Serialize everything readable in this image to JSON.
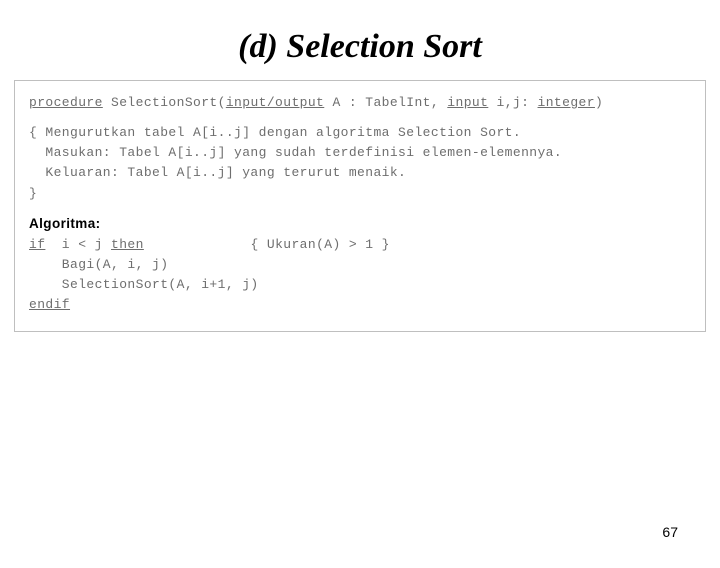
{
  "title": "(d)  Selection Sort",
  "sig": {
    "kw_procedure": "procedure",
    "name": " SelectionSort(",
    "kw_io": "input/output",
    "part1": " A : TabelInt, ",
    "kw_input": "input",
    "part2": " i,j: ",
    "kw_integer": "integer",
    "close": ")"
  },
  "comments": {
    "l1": "{ Mengurutkan tabel A[i..j] dengan algoritma Selection Sort.",
    "l2": "  Masukan: Tabel A[i..j] yang sudah terdefinisi elemen-elemennya.",
    "l3": "  Keluaran: Tabel A[i..j] yang terurut menaik.",
    "l4": "}"
  },
  "algo": {
    "label": "Algoritma:",
    "kw_if": "if",
    "cond": "  i < j ",
    "kw_then": "then",
    "cond_comment": "             { Ukuran(A) > 1 }",
    "l_bagi": "    Bagi(A, i, j)",
    "l_recur": "    SelectionSort(A, i+1, j)",
    "kw_endif": "endif"
  },
  "page_number": "67"
}
